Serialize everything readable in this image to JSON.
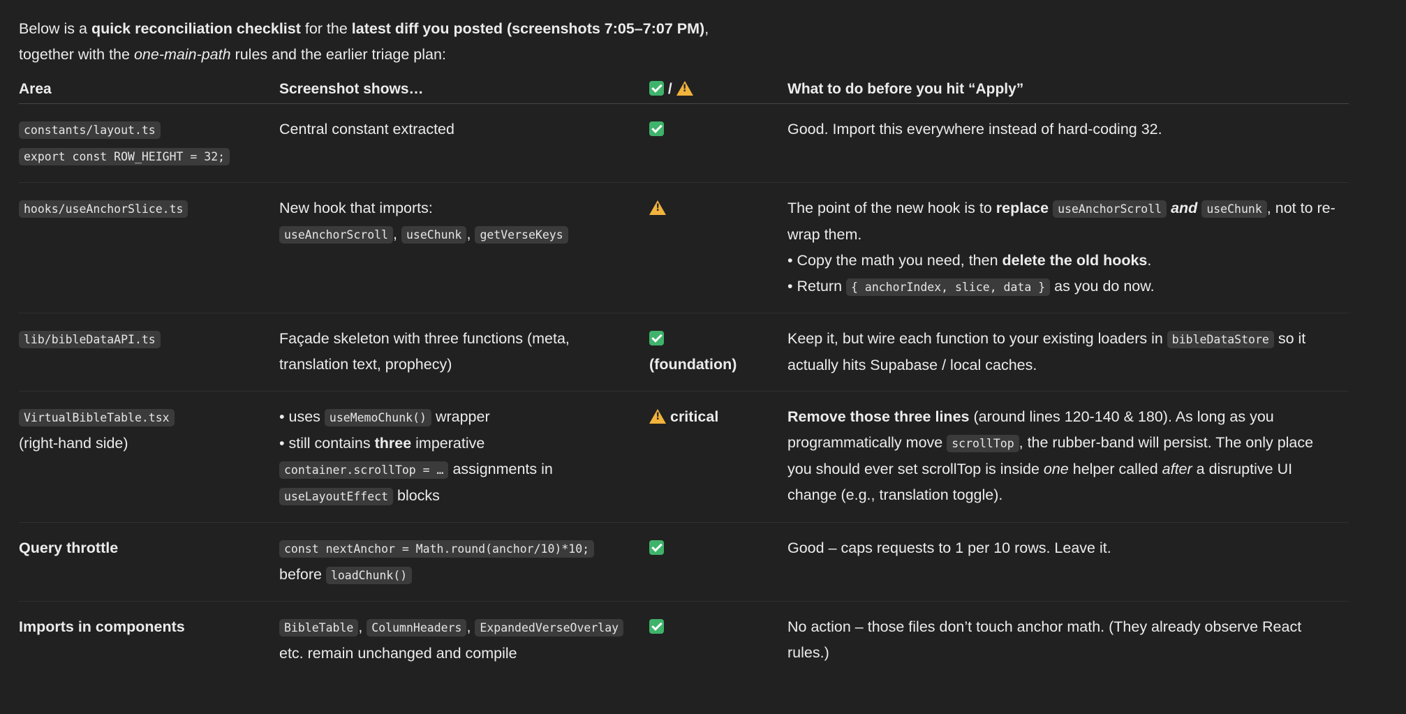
{
  "intro": {
    "p1": "Below is a ",
    "b1": "quick reconciliation checklist",
    "p2": " for the ",
    "b2": "latest diff you posted (screenshots 7:05–7:07 PM)",
    "p3": ",",
    "p4": "together with the ",
    "i1": "one-main-path",
    "p5": " rules and the earlier triage plan:"
  },
  "table": {
    "headers": {
      "area": "Area",
      "shows": "Screenshot shows…",
      "status_sep": "/",
      "todo": "What to do before you hit “Apply”"
    },
    "rows": [
      {
        "area_code1": "constants/layout.ts",
        "area_code2": "export const ROW_HEIGHT = 32;",
        "shows": "Central constant extracted",
        "status_icon": "check-icon",
        "todo": "Good. Import this everywhere instead of hard-coding 32."
      },
      {
        "area_code": "hooks/useAnchorSlice.ts",
        "shows_text": "New hook that imports:",
        "shows_codes": [
          "useAnchorScroll",
          "useChunk",
          "getVerseKeys"
        ],
        "shows_sep": ",",
        "status_icon": "warning-icon",
        "todo_a": "The point of the new hook is to ",
        "todo_b": "replace",
        "todo_code1": "useAnchorScroll",
        "todo_and": "and",
        "todo_code2": "useChunk",
        "todo_c": ", not to re-wrap them.",
        "bullet1_a": "• Copy the math you need, then ",
        "bullet1_b": "delete the old hooks",
        "bullet1_c": ".",
        "bullet2_a": "• Return ",
        "bullet2_code": "{ anchorIndex, slice, data }",
        "bullet2_b": " as you do now."
      },
      {
        "area_code": "lib/bibleDataAPI.ts",
        "shows": "Façade skeleton with three functions (meta, translation text, prophecy)",
        "status_icon": "check-icon",
        "status_label": "(foundation)",
        "todo_a": "Keep it, but wire each function to your existing loaders in ",
        "todo_code": "bibleDataStore",
        "todo_b": " so it actually hits Supabase / local caches."
      },
      {
        "area_code": "VirtualBibleTable.tsx",
        "area_text": "(right-hand side)",
        "shows_b1_a": "• uses ",
        "shows_b1_code": "useMemoChunk()",
        "shows_b1_b": " wrapper",
        "shows_b2_a": "• still contains ",
        "shows_b2_bold": "three",
        "shows_b2_b": " imperative",
        "shows_b2_code1": "container.scrollTop = …",
        "shows_b2_c": " assignments in",
        "shows_b2_code2": "useLayoutEffect",
        "shows_b2_d": " blocks",
        "status_icon": "warning-icon",
        "status_label": "critical",
        "todo_bold": "Remove those three lines",
        "todo_a": " (around lines 120-140 & 180). As long as you programmatically move ",
        "todo_code": "scrollTop",
        "todo_b": ", the rubber-band will persist. The only place you should ever set scrollTop is inside ",
        "todo_i1": "one",
        "todo_c": " helper called ",
        "todo_i2": "after",
        "todo_d": " a disruptive UI change (e.g., translation toggle)."
      },
      {
        "area": "Query throttle",
        "shows_code1": "const nextAnchor = Math.round(anchor/10)*10;",
        "shows_text": "before ",
        "shows_code2": "loadChunk()",
        "status_icon": "check-icon",
        "todo": "Good – caps requests to 1 per 10 rows. Leave it."
      },
      {
        "area": "Imports in components",
        "shows_code1": "BibleTable",
        "shows_code2": "ColumnHeaders",
        "shows_code3": "ExpandedVerseOverlay",
        "shows_text": " etc. remain unchanged and compile",
        "status_icon": "check-icon",
        "todo": "No action – those files don’t touch anchor math. (They already observe React rules.)"
      }
    ]
  },
  "colors": {
    "background": "#212121",
    "text": "#ececec",
    "code_bg": "#3b3b3b",
    "check": "#3fb36b",
    "warning": "#f2b33d"
  }
}
